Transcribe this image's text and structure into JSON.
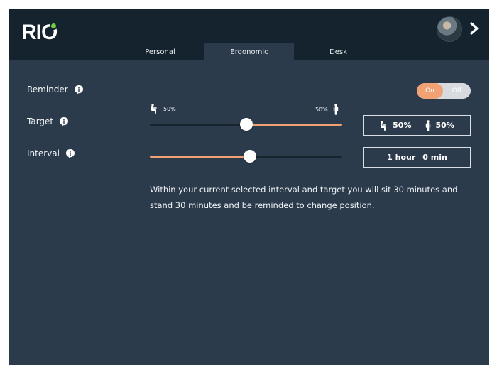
{
  "brand": {
    "logo_text": "RIO",
    "logo_dot_color": "#6fcf3d"
  },
  "header": {
    "avatar_label": "user avatar",
    "tabs": [
      {
        "label": "Personal",
        "active": false
      },
      {
        "label": "Ergonomic",
        "active": true
      },
      {
        "label": "Desk",
        "active": false
      }
    ]
  },
  "settings": {
    "reminder": {
      "label": "Reminder",
      "toggle_on": "On",
      "toggle_off": "Off",
      "state": "On"
    },
    "target": {
      "label": "Target",
      "sit_percent": "50%",
      "stand_percent": "50%",
      "slider_value": 0.5,
      "summary_sit": "50%",
      "summary_stand": "50%"
    },
    "interval": {
      "label": "Interval",
      "slider_value": 0.52,
      "hours_text": "1 hour",
      "minutes_text": "0 min"
    }
  },
  "message": {
    "text": "Within your current selected interval and target you will sit 30 minutes and stand 30 minutes and be reminded to change position."
  },
  "colors": {
    "accent": "#f1a275",
    "background": "#2c3b4c",
    "header": "#14232d",
    "track": "#17232d"
  },
  "icons": {
    "info": "info-icon",
    "sit": "sitting-person-icon",
    "stand": "standing-person-icon",
    "chevron": "chevron-right-icon"
  }
}
